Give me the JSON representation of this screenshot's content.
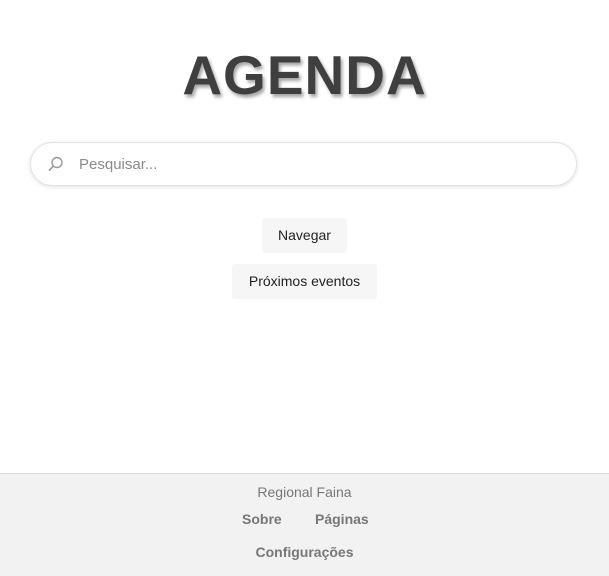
{
  "header": {
    "title": "AGENDA"
  },
  "search": {
    "placeholder": "Pesquisar...",
    "value": "",
    "icon": "search-icon"
  },
  "actions": {
    "browse_label": "Navegar",
    "upcoming_label": "Próximos eventos"
  },
  "footer": {
    "organization": "Regional Faina",
    "links": {
      "about": "Sobre",
      "pages": "Páginas",
      "settings": "Configurações"
    }
  },
  "colors": {
    "title": "#3f3f3f",
    "button_bg": "#f6f6f6",
    "footer_bg": "#f2f2f2",
    "footer_text": "#777777"
  }
}
